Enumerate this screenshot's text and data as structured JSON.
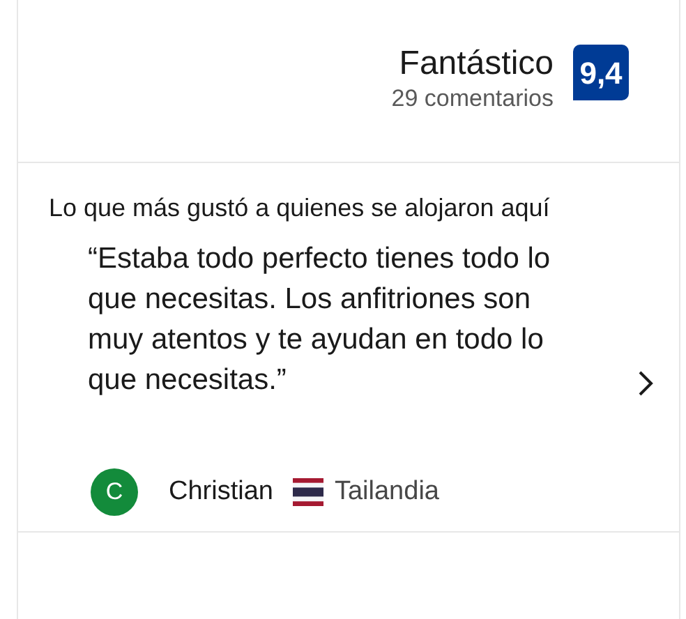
{
  "rating": {
    "label": "Fantástico",
    "reviews": "29 comentarios",
    "score": "9,4"
  },
  "highlights": {
    "heading": "Lo que más gustó a quienes se alojaron aquí",
    "quote": "“Estaba todo perfecto tienes todo lo que necesitas. Los anfitriones son muy atentos y te ayudan en todo lo que necesitas.”",
    "reviewer": {
      "initial": "C",
      "name": "Christian",
      "country": "Tailandia",
      "color": "#138b3b"
    }
  }
}
